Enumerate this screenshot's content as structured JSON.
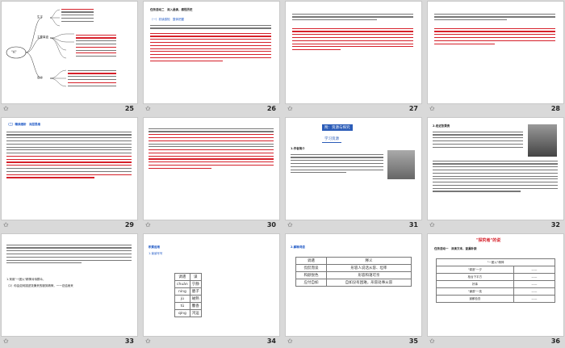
{
  "slides": [
    {
      "num": "25",
      "texts": [
        "\"A\"",
        "生平",
        "主要事迹",
        "经历",
        "个人成就",
        "思想与感情",
        "启示",
        "表现方式"
      ]
    },
    {
      "num": "26",
      "texts": [
        "任务活动二　深入品读，感悟历史",
        "（一）初读感知　整体把握",
        "答案"
      ]
    },
    {
      "num": "27",
      "texts": [
        "2.\"张秉贵牛掌的\"一般以下几段，它们对于张秉贵作用的塑造有什么作用？",
        "答案"
      ]
    },
    {
      "num": "28",
      "texts": [
        "3.\"张秉贵我一一\"一般以下几段，新闻报道\"张秉贵是工作中的表现，这些事情是否表明他是一个\"好人\"？",
        "答案"
      ]
    },
    {
      "num": "29",
      "texts": [
        "（二）精读细析　深层思维",
        "4.文章运用了大量的描写来塑造张秉贵，请举例说明。",
        "答案"
      ]
    },
    {
      "num": "30",
      "texts": [
        "（2）讲述后来张秉贵的服务工作情况，对他们有何意义？",
        "答案",
        "（3）诵读课文，探讨人物形象。"
      ]
    },
    {
      "num": "31",
      "texts": [
        "附：资源与探究",
        "学习资源",
        "1.作者简介"
      ]
    },
    {
      "num": "32",
      "texts": [
        "2.走近张秉贵",
        "张秉贵（1918—1987），北京人，共产党员。"
      ]
    },
    {
      "num": "33",
      "texts": [
        "1.采用\"一团火\"精神对待群众，",
        "（2）你会如何描述张秉贵的服务精神，一一总结而来"
      ]
    },
    {
      "num": "34",
      "texts": [
        "积累运用",
        "1.读读写写",
        "调遣",
        "谋",
        "chuán",
        "宁静",
        "níng",
        "膳子",
        "jù",
        "磁熟",
        "tū",
        "馨香",
        "qìng",
        "鸿运",
        "yùn hē"
      ]
    },
    {
      "num": "35",
      "texts": [
        "2.解释词语",
        "调遣",
        "释义",
        "侃侃而谈",
        "形容人说话从容、坦率",
        "和颜悦色",
        "形容和蔼可亲",
        "应付自如",
        "自如没有困难，形容处事从容"
      ]
    },
    {
      "num": "36",
      "texts": [
        "\"探究者\"的说",
        "任务活动一　深读文本，查漏补缺",
        "\"一团火\"精神",
        "\"调遣\"一夕",
        "柜台下平方",
        "好事",
        "\"谦逊\"一技",
        "道歉检查"
      ]
    }
  ]
}
